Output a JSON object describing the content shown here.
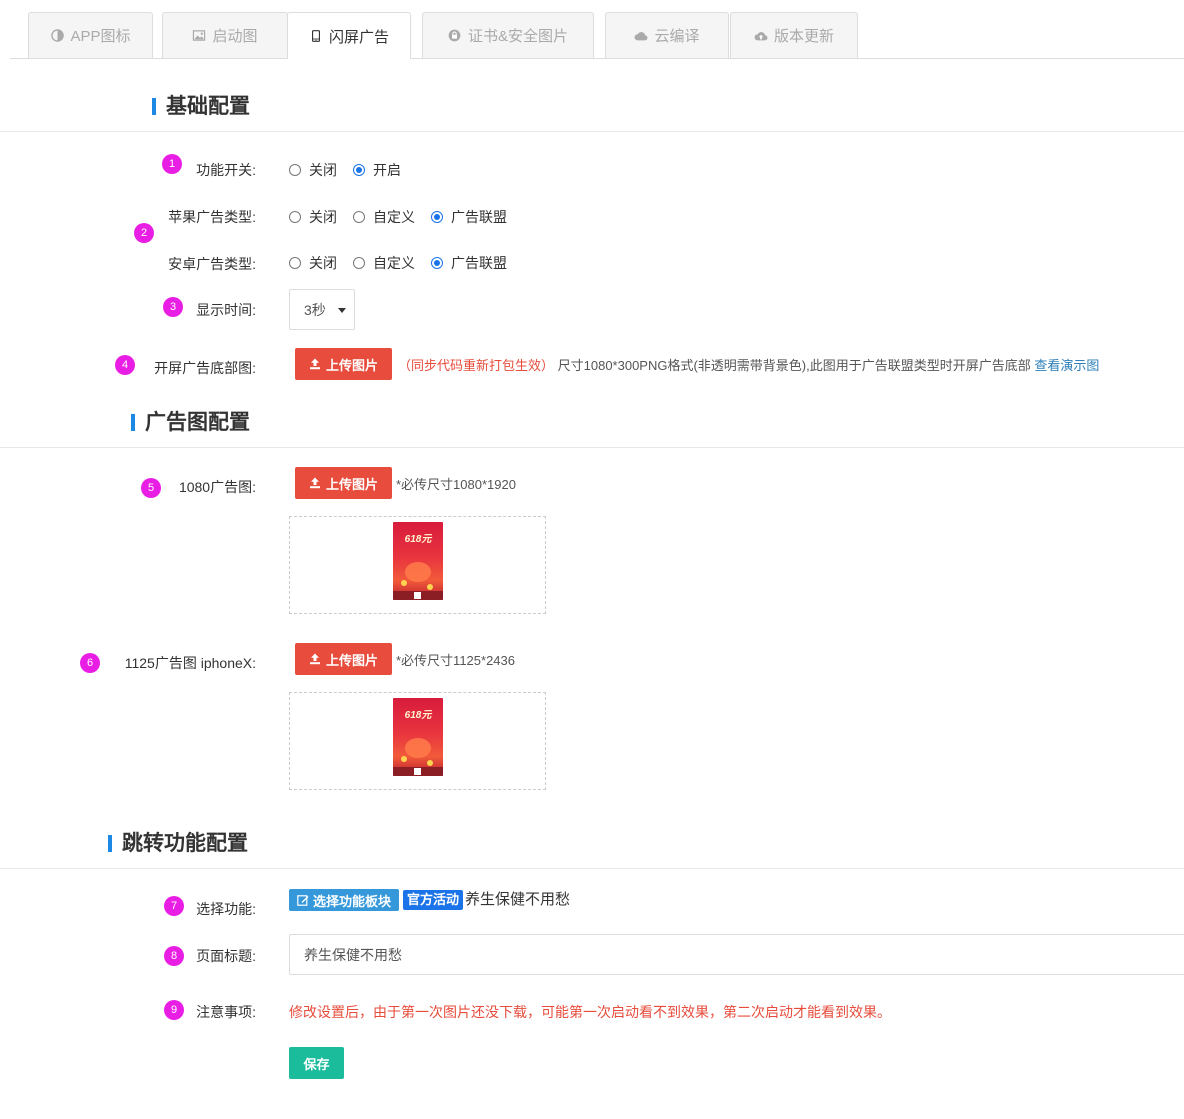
{
  "tabs": [
    {
      "label": "APP图标",
      "icon": "half-circle-icon"
    },
    {
      "label": "启动图",
      "icon": "image-icon"
    },
    {
      "label": "闪屏广告",
      "icon": "mobile-icon",
      "active": true
    },
    {
      "label": "证书&安全图片",
      "icon": "lock-icon"
    },
    {
      "label": "云编译",
      "icon": "cloud-icon"
    },
    {
      "label": "版本更新",
      "icon": "cloud-upload-icon"
    }
  ],
  "sections": {
    "basic": "基础配置",
    "ad_image": "广告图配置",
    "jump": "跳转功能配置"
  },
  "badges": [
    "1",
    "2",
    "3",
    "4",
    "5",
    "6",
    "7",
    "8",
    "9"
  ],
  "fields": {
    "switch": {
      "label": "功能开关:",
      "options": [
        "关闭",
        "开启"
      ],
      "selected": "开启"
    },
    "apple_ad_type": {
      "label": "苹果广告类型:",
      "options": [
        "关闭",
        "自定义",
        "广告联盟"
      ],
      "selected": "广告联盟"
    },
    "android_ad_type": {
      "label": "安卓广告类型:",
      "options": [
        "关闭",
        "自定义",
        "广告联盟"
      ],
      "selected": "广告联盟"
    },
    "display_time": {
      "label": "显示时间:",
      "value": "3秒"
    },
    "bottom_image": {
      "label": "开屏广告底部图:",
      "upload_label": "上传图片",
      "hint_red": "（同步代码重新打包生效）",
      "hint": "尺寸1080*300PNG格式(非透明需带背景色),此图用于广告联盟类型时开屏广告底部",
      "link": "查看演示图"
    },
    "ad_1080": {
      "label": "1080广告图:",
      "upload_label": "上传图片",
      "hint": "*必传尺寸1080*1920",
      "poster_title": "618元"
    },
    "ad_1125": {
      "label": "1125广告图 iphoneX:",
      "upload_label": "上传图片",
      "hint": "*必传尺寸1125*2436",
      "poster_title": "618元"
    },
    "select_function": {
      "label": "选择功能:",
      "button_label": "选择功能板块",
      "tag": "官方活动",
      "value": "养生保健不用愁"
    },
    "page_title": {
      "label": "页面标题:",
      "value": "养生保健不用愁"
    },
    "notice": {
      "label": "注意事项:",
      "text": "修改设置后，由于第一次图片还没下载，可能第一次启动看不到效果，第二次启动才能看到效果。"
    }
  },
  "save_label": "保存",
  "colors": {
    "accent_blue": "#1e88e5",
    "upload_red": "#e74c3c",
    "badge_magenta": "#e91ee5",
    "save_green": "#1abc9c",
    "function_blue": "#3498db"
  }
}
